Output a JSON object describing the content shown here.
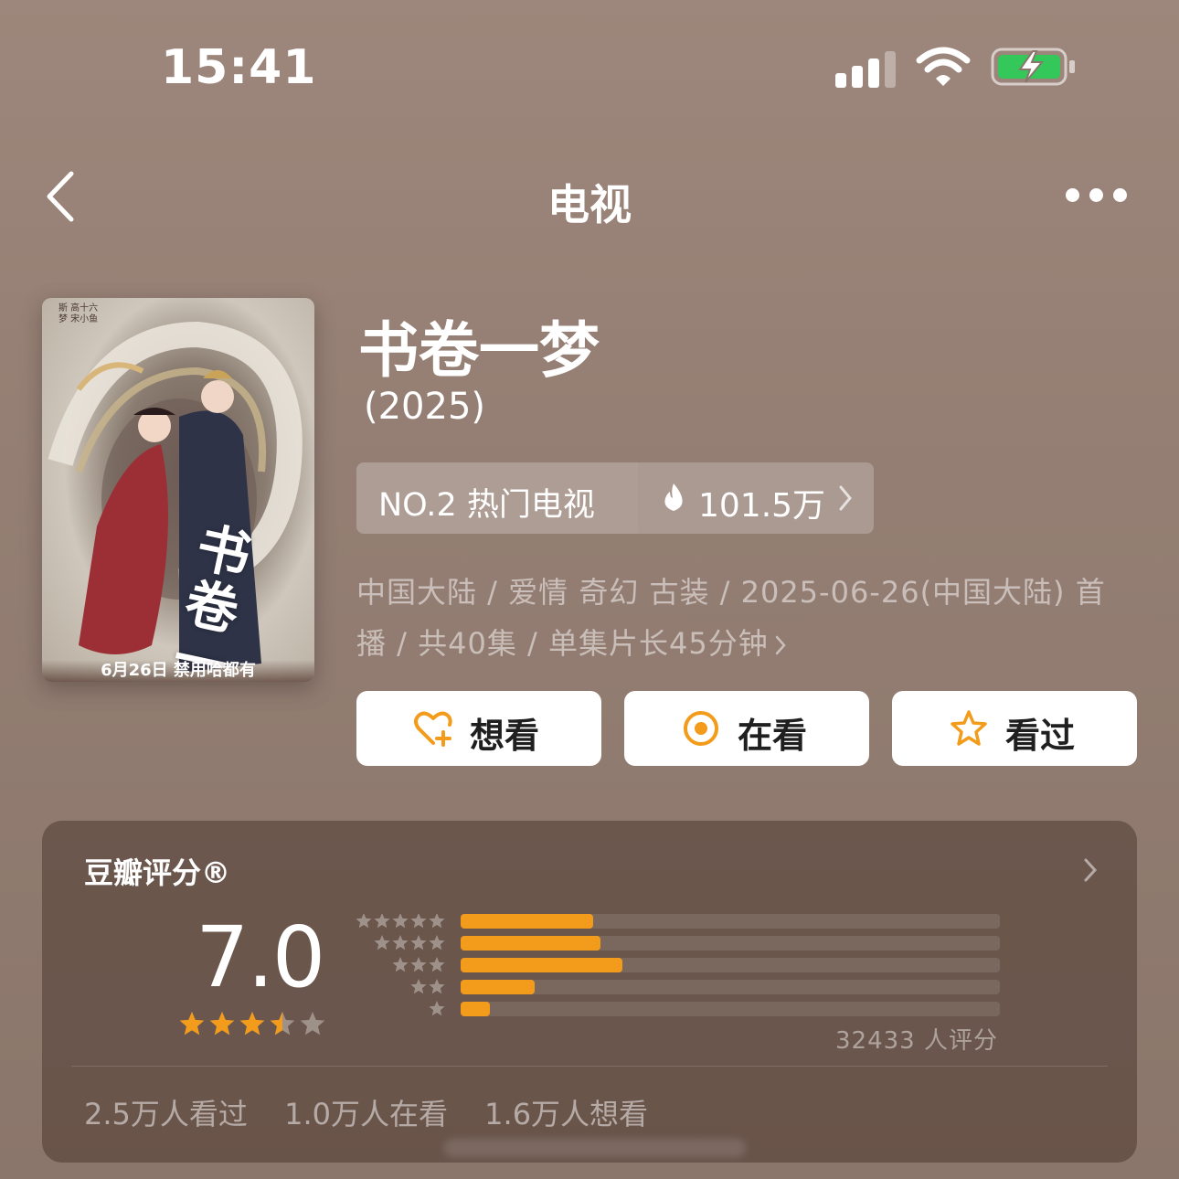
{
  "status_bar": {
    "time": "15:41",
    "signal_icon": "cellular-signal-icon",
    "wifi_icon": "wifi-icon",
    "battery_icon": "battery-charging-icon"
  },
  "nav": {
    "title": "电视",
    "back_icon": "chevron-left-icon",
    "more_icon": "more-dots-icon"
  },
  "poster": {
    "caption": "6月26日 禁用哈都有",
    "brand": "斯 高十六 梦 宋小鱼",
    "calligraphy": "书卷一梦"
  },
  "show": {
    "title": "书卷一梦",
    "year": "(2025)",
    "rank_label": "NO.2 热门电视",
    "heat_value": "101.5万",
    "meta_line1": "中国大陆 / 爱情 奇幻 古装 / 2025-06-26(中国大陆) 首",
    "meta_line2": "播 / 共40集 / 单集片长45分钟"
  },
  "actions": [
    {
      "label": "想看",
      "icon": "heart-plus-icon"
    },
    {
      "label": "在看",
      "icon": "target-circle-icon"
    },
    {
      "label": "看过",
      "icon": "star-outline-icon"
    }
  ],
  "rating": {
    "title": "豆瓣评分®",
    "score": "7.0",
    "stars": 3.5,
    "distribution": [
      {
        "stars": 5,
        "fraction": 0.245
      },
      {
        "stars": 4,
        "fraction": 0.26
      },
      {
        "stars": 3,
        "fraction": 0.3
      },
      {
        "stars": 2,
        "fraction": 0.138
      },
      {
        "stars": 1,
        "fraction": 0.054
      }
    ],
    "count_text": "32433 人评分",
    "watched": "2.5万人看过",
    "watching": "1.0万人在看",
    "want": "1.6万人想看"
  },
  "colors": {
    "accent": "#f39b1a",
    "background": "#957f74",
    "button": "#ffffff"
  }
}
